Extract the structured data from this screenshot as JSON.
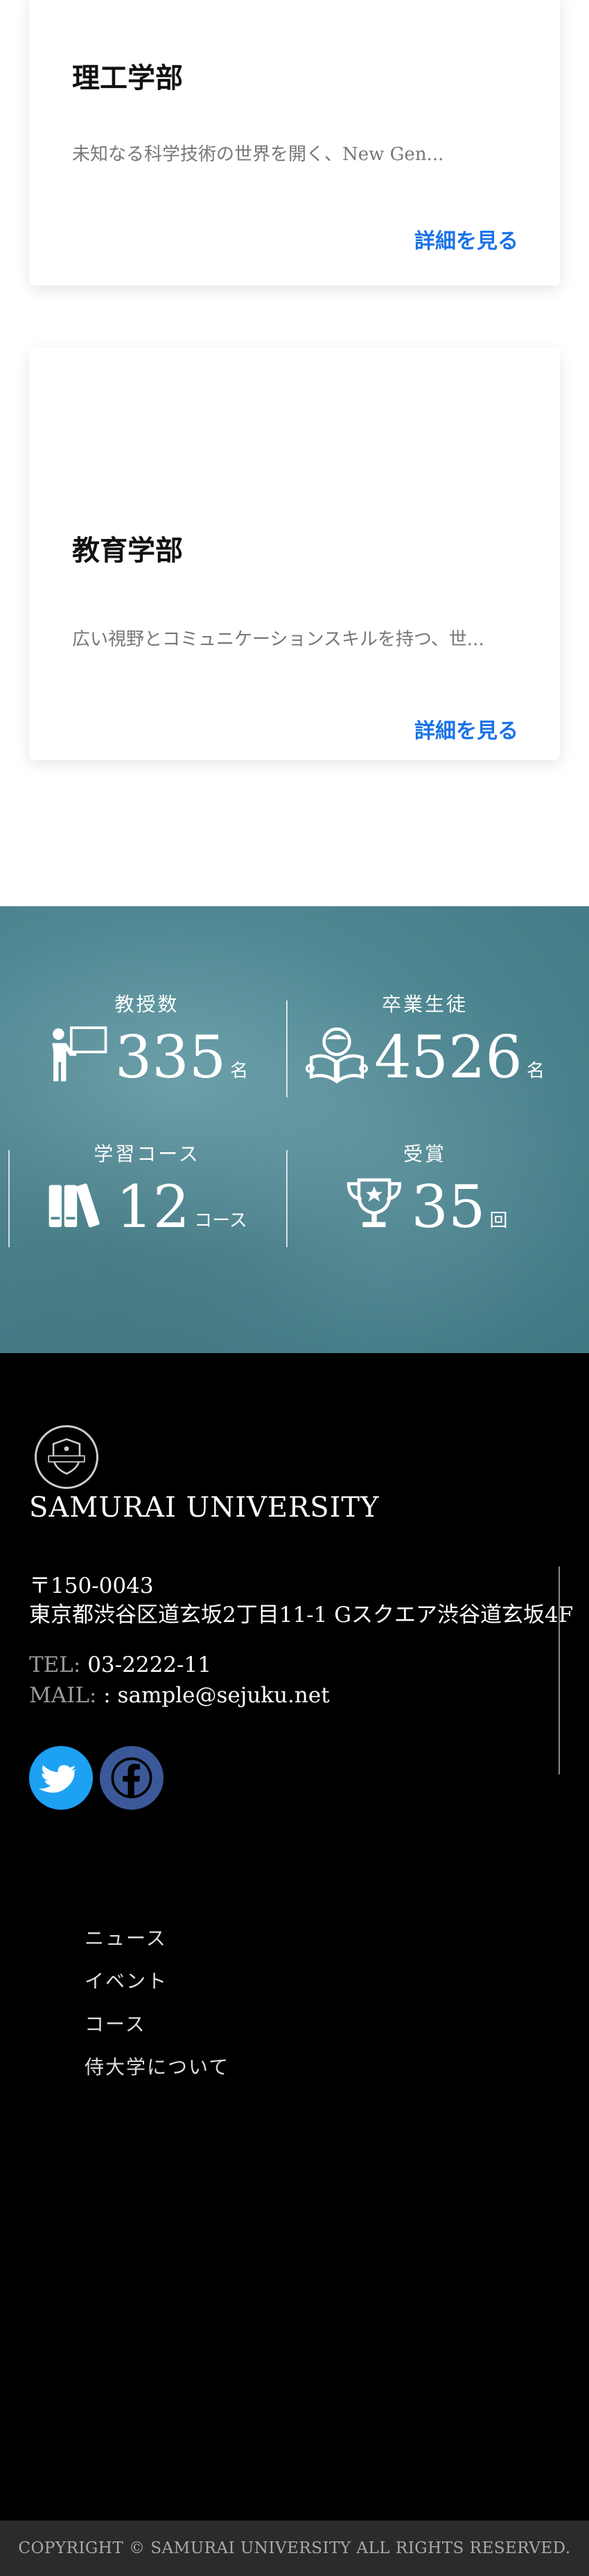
{
  "cards": [
    {
      "title": "理工学部",
      "desc": "未知なる科学技術の世界を開く、New Gen...",
      "link": "詳細を見る"
    },
    {
      "title": "教育学部",
      "desc": "広い視野とコミュニケーションスキルを持つ、世...",
      "link": "詳細を見る"
    }
  ],
  "stats": [
    {
      "label": "教授数",
      "value": "335",
      "unit": "名",
      "icon": "professor-icon"
    },
    {
      "label": "卒業生徒",
      "value": "4526",
      "unit": "名",
      "icon": "reading-student-icon"
    },
    {
      "label": "学習コース",
      "value": "12",
      "unit": "コース",
      "icon": "books-icon"
    },
    {
      "label": "受賞",
      "value": "35",
      "unit": "回",
      "icon": "trophy-icon"
    }
  ],
  "footer": {
    "university": "SAMURAI UNIVERSITY",
    "postal": "〒150-0043",
    "address": "東京都渋谷区道玄坂2丁目11-1 Gスクエア渋谷道玄坂4F",
    "tel_label": "TEL:",
    "tel": " 03-2222-11",
    "mail_label": "MAIL:",
    "mail": " : sample@sejuku.net",
    "social": [
      "twitter-icon",
      "facebook-icon"
    ],
    "nav": [
      "ニュース",
      "イベント",
      "コース",
      "侍大学について"
    ],
    "copyright": "COPYRIGHT © SAMURAI UNIVERSITY ALL RIGHTS RESERVED."
  },
  "colors": {
    "accent": "#1a73e8",
    "twitter": "#1da1f2",
    "facebook": "#3b5998",
    "stats_bg": "#4f8792"
  }
}
